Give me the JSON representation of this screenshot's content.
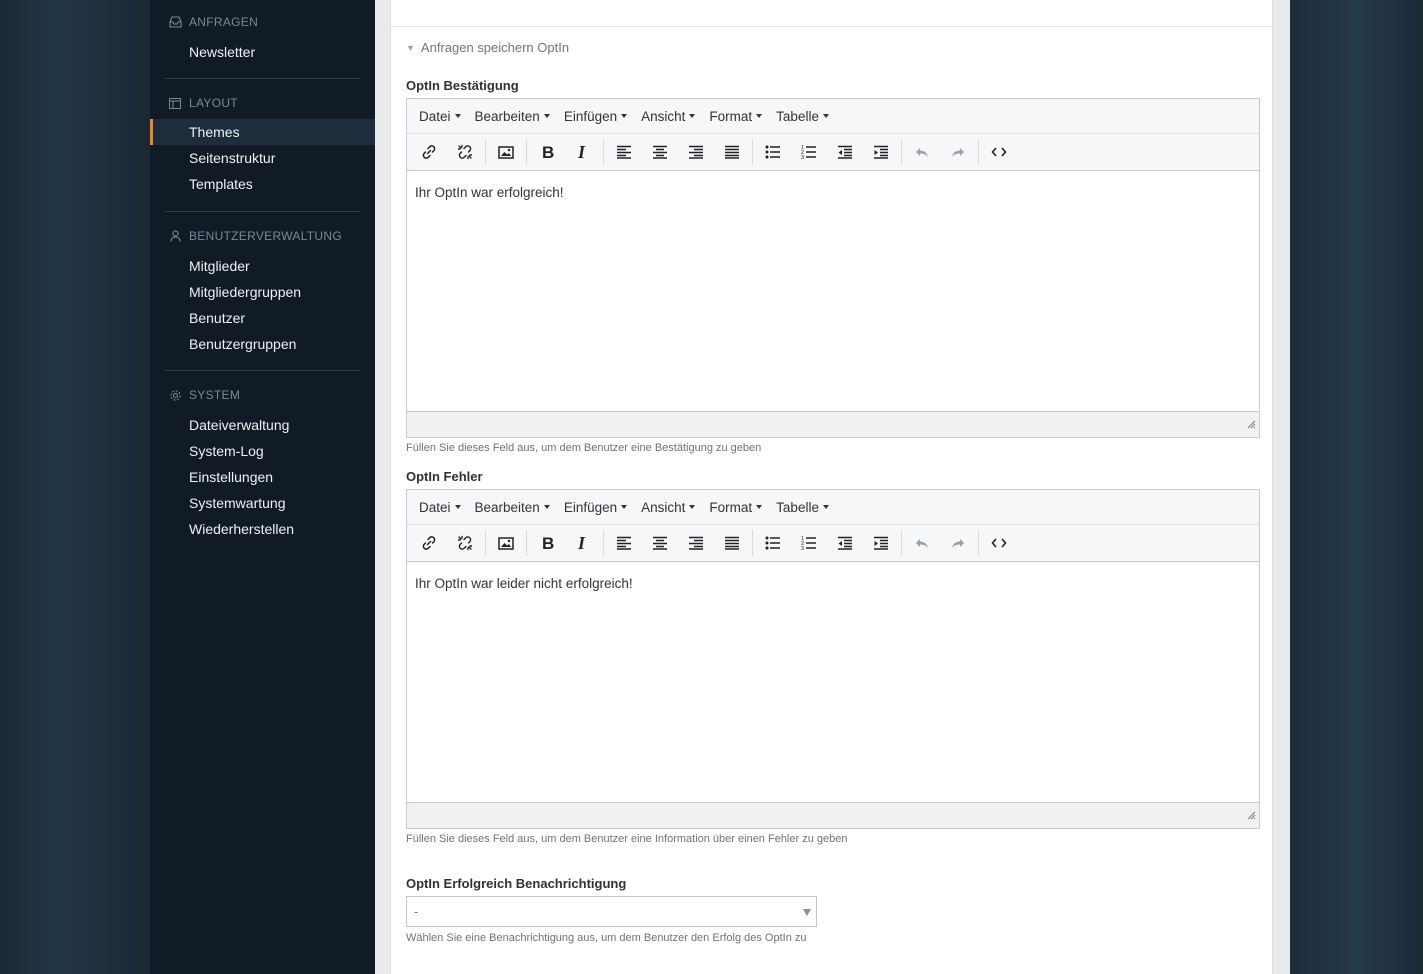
{
  "sidebar": {
    "sections": [
      {
        "title": "ANFRAGEN",
        "icon": "inbox-icon",
        "items": [
          "Newsletter"
        ]
      },
      {
        "title": "LAYOUT",
        "icon": "layout-icon",
        "items": [
          "Themes",
          "Seitenstruktur",
          "Templates"
        ],
        "active_index": 0
      },
      {
        "title": "BENUTZERVERWALTUNG",
        "icon": "user-icon",
        "items": [
          "Mitglieder",
          "Mitgliedergruppen",
          "Benutzer",
          "Benutzergruppen"
        ]
      },
      {
        "title": "SYSTEM",
        "icon": "gear-icon",
        "items": [
          "Dateiverwaltung",
          "System-Log",
          "Einstellungen",
          "Systemwartung",
          "Wiederherstellen"
        ]
      }
    ],
    "active_color": "#e88a2c"
  },
  "main": {
    "collapse_label": "Anfragen speichern OptIn",
    "editor_menu": [
      "Datei",
      "Bearbeiten",
      "Einfügen",
      "Ansicht",
      "Format",
      "Tabelle"
    ],
    "toolbar_icons": [
      "link-icon",
      "unlink-icon",
      "image-icon",
      "bold-icon",
      "italic-icon",
      "align-left-icon",
      "align-center-icon",
      "align-right-icon",
      "align-justify-icon",
      "bullet-list-icon",
      "numbered-list-icon",
      "outdent-icon",
      "indent-icon",
      "undo-icon",
      "redo-icon",
      "source-code-icon"
    ],
    "field1": {
      "label": "OptIn Bestätigung",
      "content": "Ihr OptIn war erfolgreich!",
      "help": "Füllen Sie dieses Feld aus, um dem Benutzer eine Bestätigung zu geben"
    },
    "field2": {
      "label": "OptIn Fehler",
      "content": "Ihr OptIn war leider nicht erfolgreich!",
      "help": "Füllen Sie dieses Feld aus, um dem Benutzer eine Information über einen Fehler zu geben"
    },
    "field3": {
      "label": "OptIn Erfolgreich Benachrichtigung",
      "value": "-",
      "help": "Wählen Sie eine Benachrichtigung aus, um dem Benutzer den Erfolg des OptIn zu"
    }
  }
}
